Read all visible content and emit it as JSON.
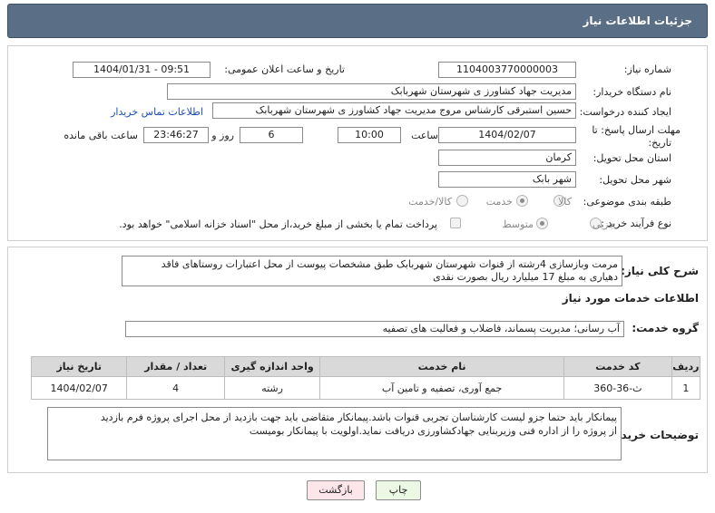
{
  "title": "جزئیات اطلاعات نیاز",
  "fields": {
    "need_number_label": "شماره نیاز:",
    "need_number": "1104003770000003",
    "announce_label": "تاریخ و ساعت اعلان عمومی:",
    "announce_value": "1404/01/31 - 09:51",
    "buyer_label": "نام دستگاه خریدار:",
    "buyer_value": "مدیریت جهاد کشاورز ی شهرستان شهربابک",
    "creator_label": "ایجاد کننده درخواست:",
    "creator_value": "حسین استبرقی کارشناس مروج مدیریت جهاد کشاورز ی شهرستان شهربابک",
    "contact_link": "اطلاعات تماس خریدار",
    "deadline_label_1": "مهلت ارسال پاسخ: تا",
    "deadline_label_2": "تاریخ:",
    "deadline_date": "1404/02/07",
    "time_label": "ساعت",
    "deadline_time": "10:00",
    "days_value": "6",
    "days_label": "روز و",
    "remaining_time": "23:46:27",
    "remaining_label": "ساعت باقی مانده",
    "province_label": "استان محل تحویل:",
    "province_value": "کرمان",
    "city_label": "شهر محل تحویل:",
    "city_value": "شهر بابک",
    "category_label": "طبقه بندی موضوعی:",
    "category_options": [
      "کالا",
      "خدمت",
      "کالا/خدمت"
    ],
    "category_selected": 1,
    "process_label": "نوع فرآیند خرید :",
    "process_options": [
      "جزیی",
      "متوسط"
    ],
    "process_selected": 1,
    "payment_note": "پرداخت تمام یا بخشی از مبلغ خرید،از محل \"اسناد خزانه اسلامی\" خواهد بود."
  },
  "description": {
    "label": "شرح کلی نیاز:",
    "line1": "مرمت وبازسازی 4رشته از قنوات شهرستان شهربابک طبق مشخصات پیوست از محل اعتبارات روستاهای فاقد",
    "line2": "دهیاری به مبلغ 17 میلیارد  ریال بصورت نقدی"
  },
  "services": {
    "section_title": "اطلاعات خدمات مورد نیاز",
    "group_label": "گروه خدمت:",
    "group_value": "آب رسانی؛ مدیریت پسماند، فاضلاب و فعالیت های تصفیه",
    "columns": [
      "ردیف",
      "کد خدمت",
      "نام خدمت",
      "واحد اندازه گیری",
      "تعداد / مقدار",
      "تاریخ نیاز"
    ],
    "rows": [
      [
        "1",
        "ث-36-360",
        "جمع آوری، تصفیه و تامین آب",
        "رشته",
        "4",
        "1404/02/07"
      ]
    ]
  },
  "buyer_notes": {
    "label": "توضیحات خریدار:",
    "line1": "پیمانکار باید حتما جزو لیست کارشناسان تجربی قنوات باشد.پیمانکار متقاضی باید جهت بازدید از محل اجرای پروژه فرم بازدید",
    "line2": "از پروژه را از اداره فنی وزیربنایی جهادکشاورزی دریافت نماید.اولویت با پیمانکار بومیست"
  },
  "buttons": {
    "print": "چاپ",
    "back": "بازگشت"
  },
  "colors": {
    "title_bar": "#5a6e86",
    "back_button": "#fde6ea",
    "print_button": "#eaf8e4",
    "link": "#1a4fb0"
  }
}
